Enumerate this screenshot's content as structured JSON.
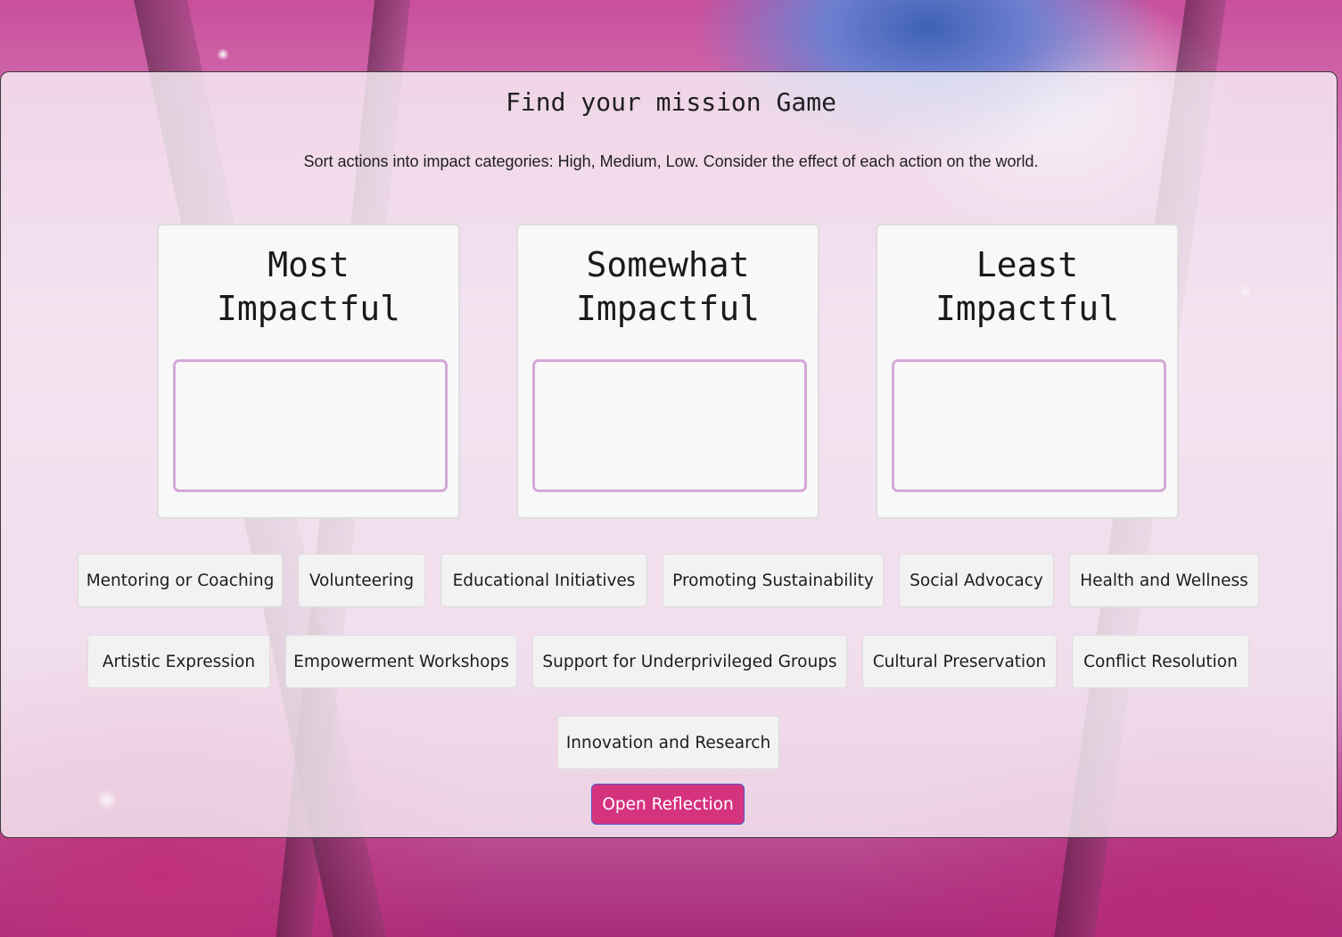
{
  "game": {
    "title": "Find your mission Game",
    "instructions": "Sort actions into impact categories: High, Medium, Low. Consider the effect of each action on the world."
  },
  "categories": [
    {
      "id": "most",
      "title": "Most\nImpactful"
    },
    {
      "id": "somewhat",
      "title": "Somewhat\nImpactful"
    },
    {
      "id": "least",
      "title": "Least\nImpactful"
    }
  ],
  "actions": [
    "Mentoring or Coaching",
    "Volunteering",
    "Educational Initiatives",
    "Promoting Sustainability",
    "Social Advocacy",
    "Health and Wellness",
    "Artistic Expression",
    "Empowerment Workshops",
    "Support for Underprivileged Groups",
    "Cultural Preservation",
    "Conflict Resolution",
    "Innovation and Research"
  ],
  "buttons": {
    "open_reflection": "Open Reflection"
  },
  "colors": {
    "button_bg": "#d6337f",
    "drop_zone_border": "#d4a8d6",
    "panel_bg": "#f8f2f8"
  }
}
